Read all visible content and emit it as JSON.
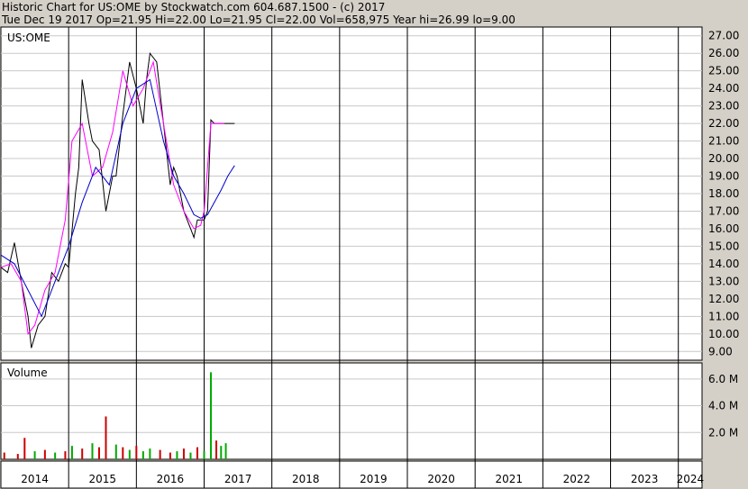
{
  "header": {
    "line1": "Historic Chart for US:OME  by Stockwatch.com 604.687.1500 - (c) 2017",
    "line2": "Tue Dec 19 2017   Op=21.95   Hi=22.00   Lo=21.95   Cl=22.00   Vol=658,975   Year hi=26.99   lo=9.00"
  },
  "chart_data": [
    {
      "type": "line",
      "title": "US:OME",
      "ylim": [
        8.5,
        27.5
      ],
      "y_ticks": [
        "27.00",
        "26.00",
        "25.00",
        "24.00",
        "23.00",
        "22.00",
        "21.00",
        "20.00",
        "19.00",
        "18.00",
        "17.00",
        "16.00",
        "15.00",
        "14.00",
        "13.00",
        "12.00",
        "11.00",
        "10.00",
        "9.00"
      ],
      "x_ticks": [
        "2014",
        "2015",
        "2016",
        "2017",
        "2018",
        "2019",
        "2020",
        "2021",
        "2022",
        "2023",
        "2024"
      ],
      "x_range": [
        2014.0,
        2024.35
      ],
      "series": [
        {
          "color": "#000000",
          "x": [
            2014.0,
            2014.1,
            2014.2,
            2014.3,
            2014.35,
            2014.4,
            2014.45,
            2014.55,
            2014.65,
            2014.75,
            2014.85,
            2014.95,
            2015.0,
            2015.1,
            2015.15,
            2015.2,
            2015.3,
            2015.35,
            2015.45,
            2015.55,
            2015.65,
            2015.7,
            2015.8,
            2015.9,
            2016.0,
            2016.1,
            2016.15,
            2016.2,
            2016.3,
            2016.4,
            2016.5,
            2016.55,
            2016.6,
            2016.7,
            2016.75,
            2016.8,
            2016.85,
            2016.9,
            2017.0,
            2017.05,
            2017.1,
            2017.15,
            2017.2,
            2017.25,
            2017.3,
            2017.35,
            2017.4,
            2017.45
          ],
          "values": [
            13.8,
            13.5,
            15.2,
            13.0,
            12.0,
            11.0,
            9.2,
            10.5,
            11.0,
            13.5,
            13.0,
            14.0,
            13.8,
            18.0,
            19.5,
            24.5,
            22.0,
            21.0,
            20.5,
            17.0,
            19.0,
            19.0,
            22.5,
            25.5,
            24.0,
            22.0,
            24.5,
            26.0,
            25.5,
            22.0,
            18.5,
            19.5,
            19.0,
            17.0,
            16.5,
            16.0,
            15.5,
            16.5,
            16.5,
            17.0,
            22.2,
            22.0,
            22.0,
            22.0,
            22.0,
            22.0,
            22.0,
            22.0
          ]
        },
        {
          "color": "#ff00ff",
          "x": [
            2014.0,
            2014.15,
            2014.3,
            2014.4,
            2014.5,
            2014.65,
            2014.8,
            2014.95,
            2015.05,
            2015.2,
            2015.35,
            2015.5,
            2015.65,
            2015.8,
            2015.95,
            2016.1,
            2016.25,
            2016.4,
            2016.55,
            2016.7,
            2016.85,
            2016.95,
            2017.0,
            2017.05,
            2017.1,
            2017.2,
            2017.3
          ],
          "values": [
            13.8,
            14.0,
            13.0,
            10.0,
            10.5,
            12.5,
            13.5,
            16.5,
            21.0,
            22.0,
            19.0,
            19.5,
            21.5,
            25.0,
            23.0,
            24.0,
            25.5,
            22.0,
            18.5,
            17.0,
            16.0,
            16.2,
            17.0,
            19.5,
            22.0,
            22.0,
            22.0
          ]
        },
        {
          "color": "#0000cc",
          "x": [
            2014.0,
            2014.2,
            2014.4,
            2014.6,
            2014.8,
            2015.0,
            2015.2,
            2015.4,
            2015.6,
            2015.8,
            2016.0,
            2016.2,
            2016.4,
            2016.55,
            2016.7,
            2016.85,
            2016.95,
            2017.05,
            2017.15,
            2017.25,
            2017.35,
            2017.45
          ],
          "values": [
            14.5,
            14.0,
            12.5,
            11.0,
            13.0,
            15.0,
            17.5,
            19.5,
            18.5,
            22.0,
            24.0,
            24.5,
            21.0,
            19.0,
            18.0,
            16.8,
            16.6,
            16.8,
            17.5,
            18.2,
            19.0,
            19.6
          ]
        }
      ]
    },
    {
      "type": "bar",
      "title": "Volume",
      "ylim": [
        0,
        7.2
      ],
      "y_ticks": [
        "6.0 M",
        "4.0 M",
        "2.0 M"
      ],
      "x_range": [
        2014.0,
        2024.35
      ],
      "up_color": "#00aa00",
      "down_color": "#cc0000",
      "x": [
        2014.05,
        2014.25,
        2014.35,
        2014.5,
        2014.65,
        2014.8,
        2014.95,
        2015.05,
        2015.2,
        2015.35,
        2015.45,
        2015.55,
        2015.7,
        2015.8,
        2015.9,
        2016.0,
        2016.1,
        2016.2,
        2016.35,
        2016.5,
        2016.6,
        2016.7,
        2016.8,
        2016.9,
        2017.0,
        2017.1,
        2017.18,
        2017.25,
        2017.32
      ],
      "values": [
        0.5,
        0.4,
        1.6,
        0.6,
        0.7,
        0.5,
        0.6,
        1.0,
        0.8,
        1.2,
        0.9,
        3.2,
        1.1,
        0.9,
        0.7,
        1.0,
        0.6,
        0.8,
        0.7,
        0.5,
        0.6,
        0.8,
        0.5,
        0.9,
        0.6,
        6.5,
        1.4,
        1.0,
        1.2
      ],
      "colors": [
        "down",
        "down",
        "down",
        "up",
        "down",
        "up",
        "down",
        "up",
        "down",
        "up",
        "down",
        "down",
        "up",
        "down",
        "up",
        "down",
        "up",
        "up",
        "down",
        "down",
        "up",
        "down",
        "up",
        "down",
        "up",
        "up",
        "down",
        "up",
        "up"
      ]
    }
  ]
}
